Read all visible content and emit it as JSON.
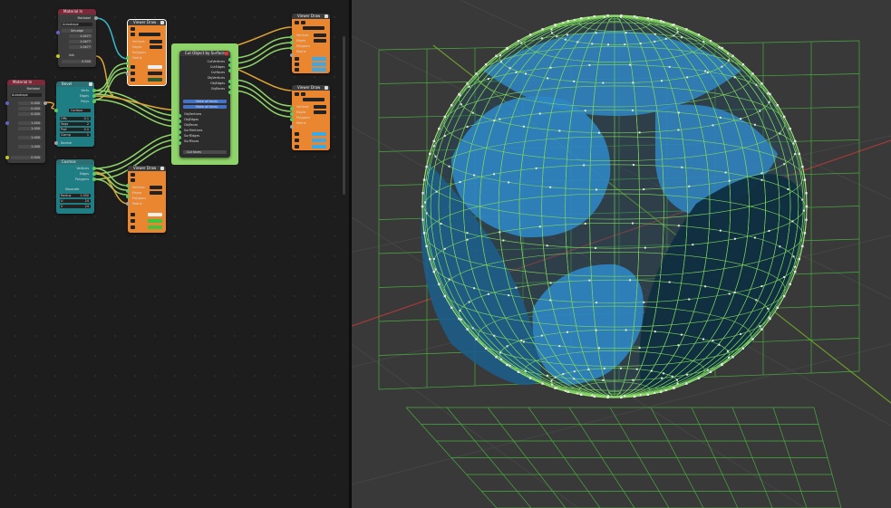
{
  "node_editor": {
    "material_node_1": {
      "title": "Material In",
      "mode": "Matlabel",
      "dropdown": "Autodrape",
      "field": "Smudge",
      "values": [
        "1.0477",
        "1.0477",
        "1.0477"
      ],
      "link": "link",
      "range": "0.500"
    },
    "material_node_2": {
      "title": "Material In",
      "mode": "Matlabel",
      "dropdown": "Autodrape",
      "values": [
        "0.000",
        "0.000",
        "0.000",
        "1.000",
        "1.000",
        "1.000",
        "1.000",
        "0.500"
      ]
    },
    "bevel_node": {
      "title": "Bevel",
      "outputs": [
        "Verts",
        "Edges",
        "Polys"
      ],
      "mode": "Contour",
      "fields": [
        "Offs",
        "Segs",
        "Prof",
        "Clamp"
      ],
      "field_values": [
        "0.1",
        "2",
        "0.5",
        "1"
      ],
      "extra": "Normal"
    },
    "comp_node": {
      "title": "Cosmos",
      "outputs": [
        "Vertices",
        "Edges",
        "Polygons"
      ],
      "label": "Separate",
      "fields": [
        "Radius",
        "U",
        "V"
      ],
      "field_values": [
        "1.000",
        "24",
        "24"
      ]
    },
    "viewer_draw_1": {
      "title": "Viewer Draw",
      "rows": [
        "Vertices",
        "Edges",
        "Polygons",
        "Matrix"
      ]
    },
    "viewer_draw_2": {
      "title": "Viewer Draw",
      "rows": [
        "Vertices",
        "Edges",
        "Polygons",
        "Matrix"
      ]
    },
    "viewer_draw_3": {
      "title": "Viewer Draw",
      "rows": [
        "Vertices",
        "Edges",
        "Polygons",
        "Matrix"
      ]
    },
    "viewer_draw_4": {
      "title": "Viewer Draw",
      "rows": [
        "Vertices",
        "Edges",
        "Polygons",
        "Matrix"
      ]
    },
    "cut_node": {
      "title": "Cut Object by Surface",
      "outputs": [
        "CutVertices",
        "CutEdges",
        "CutFaces",
        "ObjVertices",
        "ObjEdges",
        "ObjFaces"
      ],
      "inputs": [
        "ObjVertices",
        "ObjEdges",
        "ObjFaces",
        "SurfVertices",
        "SurfEdges",
        "SurfFaces"
      ],
      "btn1": "Make all faces",
      "btn2": "Make all faces",
      "bottom": "Cut faces"
    }
  },
  "colors": {
    "grid_line": "#4ab83f",
    "sphere_fill": "#2f86c4",
    "sphere_dark": "#0f2e40",
    "axis_x": "#b23a3a",
    "axis_y": "#6d9a2a"
  }
}
